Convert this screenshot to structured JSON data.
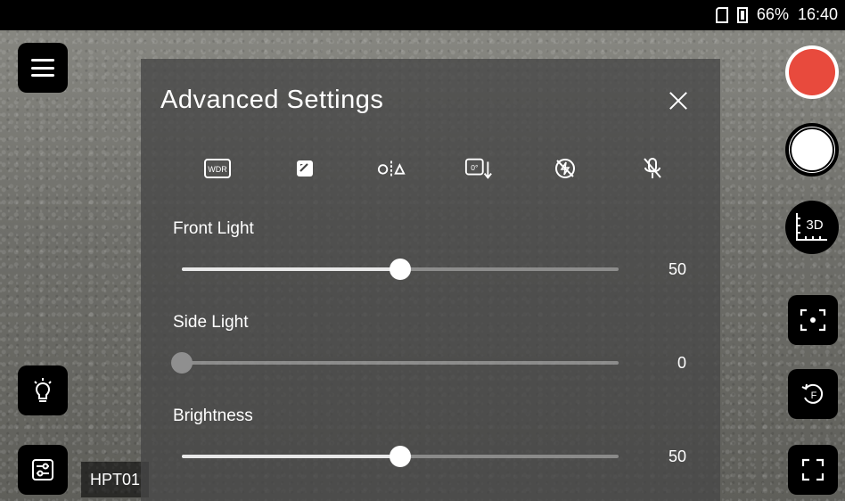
{
  "status_bar": {
    "battery": "66%",
    "time": "16:40"
  },
  "left": {
    "hpt_label": "HPT01"
  },
  "panel": {
    "title": "Advanced Settings",
    "toolbar_icons": [
      {
        "name": "wdr-icon",
        "label": "WDR"
      },
      {
        "name": "image-adjust-icon",
        "label": ""
      },
      {
        "name": "mirror-icon",
        "label": ""
      },
      {
        "name": "rotate-icon",
        "label": ""
      },
      {
        "name": "no-flash-icon",
        "label": ""
      },
      {
        "name": "mic-off-icon",
        "label": ""
      }
    ],
    "sliders": [
      {
        "label": "Front Light",
        "value": "50",
        "percent": 50
      },
      {
        "label": "Side Light",
        "value": "0",
        "percent": 0
      },
      {
        "label": "Brightness",
        "value": "50",
        "percent": 50
      }
    ]
  },
  "right": {
    "three_d_label": "3D"
  },
  "colors": {
    "record_red": "#e84a3d",
    "panel_bg": "rgba(70,70,70,0.78)"
  }
}
